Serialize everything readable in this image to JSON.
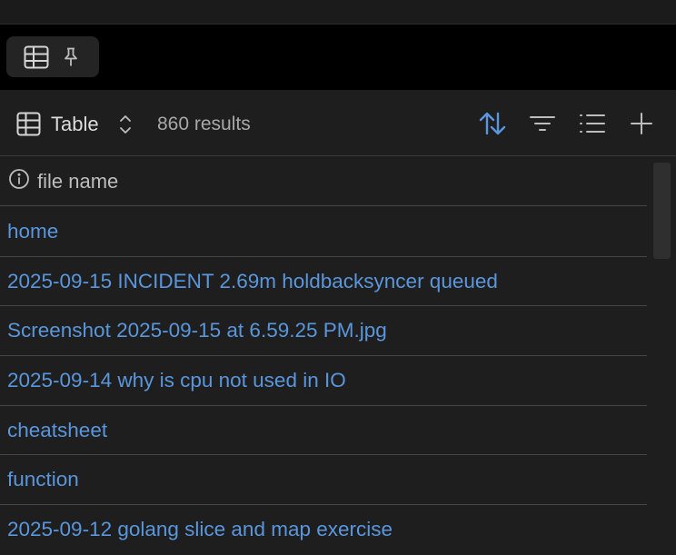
{
  "toolbar": {
    "view_label": "Table",
    "results_count": "860 results"
  },
  "table": {
    "column_header": "file name",
    "rows": [
      "home",
      "2025-09-15 INCIDENT 2.69m holdbacksyncer queued",
      "Screenshot 2025-09-15 at 6.59.25 PM.jpg",
      "2025-09-14 why is cpu not used in IO",
      "cheatsheet",
      "function",
      "2025-09-12 golang slice and map exercise"
    ]
  },
  "colors": {
    "accent": "#5a96dc",
    "background": "#1e1e1e",
    "tab_bar": "#000000"
  },
  "icons": [
    "table-icon",
    "pin-icon",
    "chevron-updown-icon",
    "sort-icon",
    "filter-icon",
    "properties-icon",
    "plus-icon",
    "info-icon"
  ]
}
